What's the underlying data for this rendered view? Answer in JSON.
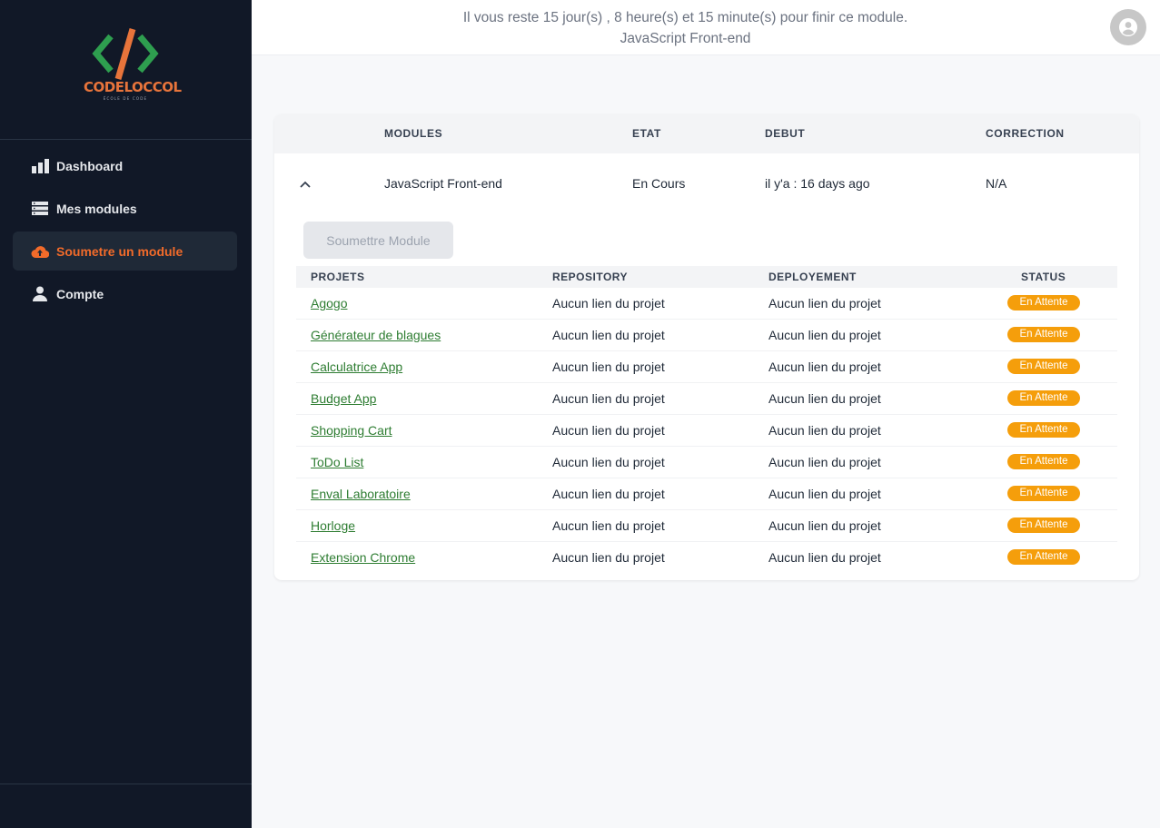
{
  "logo": {
    "text": "CODELOCCOL",
    "subtitle": "ÉCOLE DE CODE"
  },
  "sidebar": {
    "items": [
      {
        "label": "Dashboard",
        "icon": "bar-chart-icon"
      },
      {
        "label": "Mes modules",
        "icon": "list-icon"
      },
      {
        "label": "Soumetre un module",
        "icon": "cloud-upload-icon",
        "active": true
      },
      {
        "label": "Compte",
        "icon": "user-icon"
      }
    ]
  },
  "header": {
    "countdown": "Il vous reste 15 jour(s) , 8 heure(s) et 15 minute(s) pour finir ce module.",
    "module_name": "JavaScript Front-end"
  },
  "modules_table": {
    "headers": [
      "MODULES",
      "ETAT",
      "DEBUT",
      "CORRECTION"
    ],
    "row": {
      "module": "JavaScript Front-end",
      "etat": "En Cours",
      "debut": "il y'a : 16 days ago",
      "correction": "N/A"
    },
    "submit_label": "Soumettre Module"
  },
  "projects_table": {
    "headers": [
      "PROJETS",
      "REPOSITORY",
      "DEPLOYEMENT",
      "STATUS"
    ],
    "rows": [
      {
        "name": "Agogo",
        "repository": "Aucun lien du projet",
        "deployment": "Aucun lien du projet",
        "status": "En Attente"
      },
      {
        "name": "Générateur de blagues",
        "repository": "Aucun lien du projet",
        "deployment": "Aucun lien du projet",
        "status": "En Attente"
      },
      {
        "name": "Calculatrice App",
        "repository": "Aucun lien du projet",
        "deployment": "Aucun lien du projet",
        "status": "En Attente"
      },
      {
        "name": "Budget App",
        "repository": "Aucun lien du projet",
        "deployment": "Aucun lien du projet",
        "status": "En Attente"
      },
      {
        "name": "Shopping Cart",
        "repository": "Aucun lien du projet",
        "deployment": "Aucun lien du projet",
        "status": "En Attente"
      },
      {
        "name": "ToDo List",
        "repository": "Aucun lien du projet",
        "deployment": "Aucun lien du projet",
        "status": "En Attente"
      },
      {
        "name": "Enval Laboratoire",
        "repository": "Aucun lien du projet",
        "deployment": "Aucun lien du projet",
        "status": "En Attente"
      },
      {
        "name": "Horloge",
        "repository": "Aucun lien du projet",
        "deployment": "Aucun lien du projet",
        "status": "En Attente"
      },
      {
        "name": "Extension Chrome",
        "repository": "Aucun lien du projet",
        "deployment": "Aucun lien du projet",
        "status": "En Attente"
      }
    ]
  },
  "colors": {
    "sidebar_bg": "#111827",
    "accent": "#f26b2a",
    "link": "#2e7d32",
    "badge": "#f59e0b"
  }
}
